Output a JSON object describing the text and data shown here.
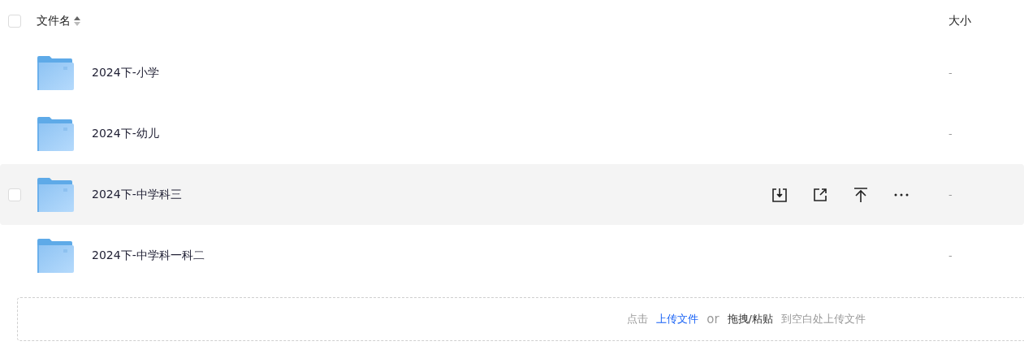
{
  "header": {
    "checked": false,
    "name_label": "文件名",
    "size_label": "大小"
  },
  "rows": [
    {
      "name": "2024下-小学",
      "size": "-",
      "hovered": false,
      "checked": false
    },
    {
      "name": "2024下-幼儿",
      "size": "-",
      "hovered": false,
      "checked": false
    },
    {
      "name": "2024下-中学科三",
      "size": "-",
      "hovered": true,
      "checked": false
    },
    {
      "name": "2024下-中学科一科二",
      "size": "-",
      "hovered": false,
      "checked": false
    }
  ],
  "upload": {
    "prefix": "点击",
    "link": "上传文件",
    "or": "or",
    "drag": "拖拽/粘贴",
    "suffix": "到空白处上传文件"
  }
}
